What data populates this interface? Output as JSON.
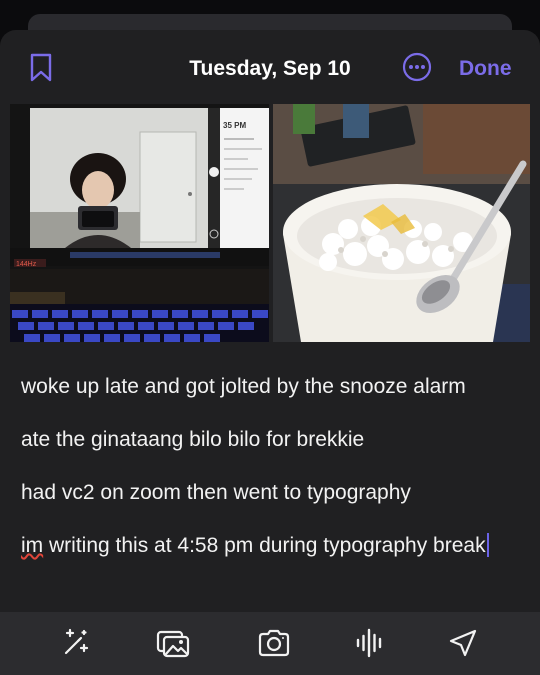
{
  "header": {
    "title": "Tuesday, Sep 10",
    "done_label": "Done"
  },
  "photos": {
    "screen_time": "35 PM",
    "brand": "144Hz"
  },
  "entry": {
    "lines": [
      "woke up late and got jolted by the snooze alarm",
      "ate the ginataang bilo bilo for brekkie",
      "had vc2 on zoom then went to typography"
    ],
    "last_line_misspelled": "im",
    "last_line_rest": " writing this at 4:58 pm during typography break"
  },
  "toolbar": {
    "icons": [
      "magic-wand-icon",
      "photo-library-icon",
      "camera-icon",
      "audio-waveform-icon",
      "location-arrow-icon"
    ]
  },
  "colors": {
    "accent": "#7b6ce8",
    "sheet_bg": "#202022",
    "toolbar_bg": "#2c2c2f",
    "spellcheck": "#e0453a"
  }
}
